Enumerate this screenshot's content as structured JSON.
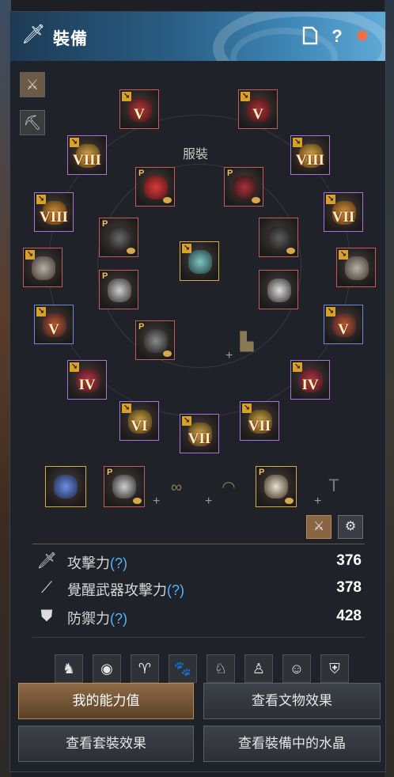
{
  "window": {
    "title": "裝備"
  },
  "header_buttons": {
    "page_icon": "page-icon",
    "help_label": "?",
    "favorite_icon": "star-icon"
  },
  "center_label": "服裝",
  "slots": {
    "left_top": "V",
    "right_top": "V",
    "left_1": "VIII",
    "right_1": "VIII",
    "left_2": "VIII",
    "right_2": "VII",
    "left_4": "V",
    "right_4": "V",
    "left_5": "IV",
    "right_5": "IV",
    "bottom_left": "VI",
    "bottom_center": "VII",
    "bottom_right": "VII",
    "p_marker": "P"
  },
  "plus_symbol": "+",
  "stats": [
    {
      "label": "攻擊力",
      "help": "(?)",
      "value": "376"
    },
    {
      "label": "覺醒武器攻擊力",
      "help": "(?)",
      "value": "378"
    },
    {
      "label": "防禦力",
      "help": "(?)",
      "value": "428"
    }
  ],
  "buttons": {
    "my_stats": "我的能力值",
    "artifact_effects": "查看文物效果",
    "set_effects": "查看套裝效果",
    "equipped_crystals": "查看裝備中的水晶"
  },
  "colors": {
    "accent": "#4fb4ff",
    "active_button": "#8e6a45",
    "header": "#2a5f86"
  }
}
